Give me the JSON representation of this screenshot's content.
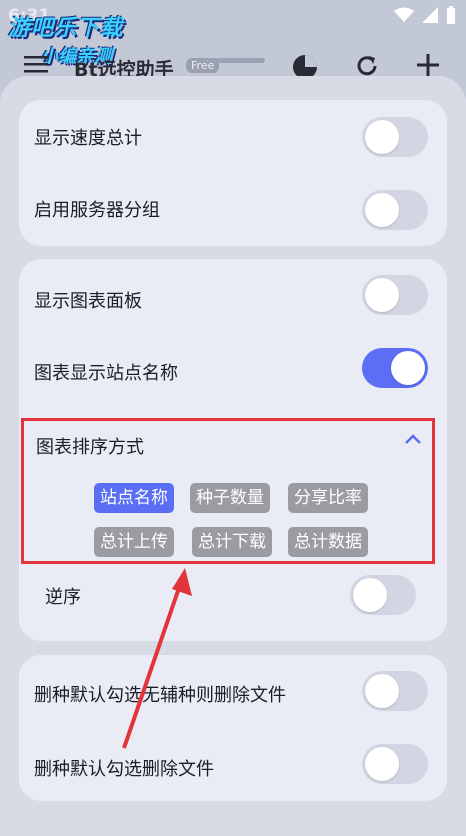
{
  "status": {
    "time": "6:31"
  },
  "watermark": {
    "line1": "游吧乐下载",
    "line2": "小编亲测"
  },
  "appbar": {
    "title": "Bt远控助手",
    "badge": "Free"
  },
  "group1": [
    {
      "label": "显示速度总计",
      "on": false
    },
    {
      "label": "启用服务器分组",
      "on": false
    }
  ],
  "group2": [
    {
      "label": "显示图表面板",
      "on": false
    },
    {
      "label": "图表显示站点名称",
      "on": true
    }
  ],
  "sort": {
    "title": "图表排序方式",
    "options": [
      "站点名称",
      "种子数量",
      "分享比率",
      "总计上传",
      "总计下载",
      "总计数据"
    ],
    "selected": "站点名称"
  },
  "reverse": {
    "label": "逆序",
    "on": false
  },
  "group3": [
    {
      "label": "删种默认勾选无辅种则删除文件",
      "on": false
    },
    {
      "label": "删种默认勾选删除文件",
      "on": false
    }
  ],
  "colors": {
    "accent": "#5a6ef5",
    "highlight": "#e3343c",
    "chip_inactive": "#9b9ca2"
  }
}
